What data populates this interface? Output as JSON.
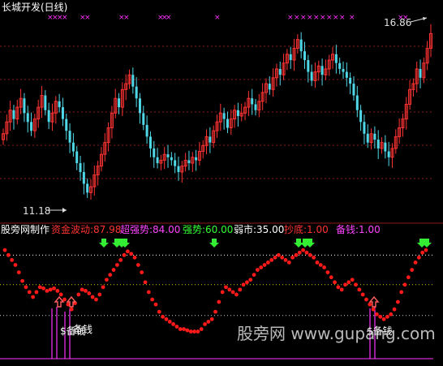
{
  "title": "长城开发(日线)",
  "price_labels": {
    "high": "16.86",
    "low": "11.18"
  },
  "indicator": {
    "name": "股旁网制作",
    "params": [
      {
        "label": "资金波动:87.98",
        "color": "#ff3333"
      },
      {
        "label": "超强势:84.00",
        "color": "#ff44ff"
      },
      {
        "label": "强势:60.00",
        "color": "#33ff33"
      },
      {
        "label": "弱市:35.00",
        "color": "#ffffff"
      },
      {
        "label": "抄底:1.00",
        "color": "#ff3333"
      },
      {
        "label": "备钱:1.00",
        "color": "#ff44ff"
      }
    ],
    "signal_labels": [
      "$备钱",
      "备钱",
      "$备钱"
    ]
  },
  "watermark": "股旁网 www.gupang.com",
  "colors": {
    "up_candle": "#ff3333",
    "down_candle": "#4fd8e8",
    "marker": "#ff33ff",
    "dot": "#ff1a1a",
    "green_arrow": "#33ee33",
    "pink_arrow": "#ff6060",
    "grid": "#8b1a1a"
  },
  "chart_data": [
    {
      "type": "candlestick",
      "title": "长城开发(日线)",
      "ylim": [
        10.5,
        17.5
      ],
      "annotations": [
        "16.86",
        "11.18"
      ],
      "close": [
        13.4,
        13.8,
        14.2,
        13.9,
        14.3,
        14.6,
        14.1,
        13.8,
        13.5,
        13.9,
        14.3,
        14.7,
        14.2,
        13.8,
        14.1,
        14.5,
        14.3,
        13.9,
        13.5,
        13.1,
        12.8,
        12.4,
        12.1,
        11.7,
        11.4,
        11.6,
        12.0,
        12.3,
        12.7,
        13.1,
        13.6,
        14.1,
        14.6,
        14.3,
        14.9,
        15.1,
        15.4,
        15.0,
        14.6,
        14.1,
        13.7,
        13.3,
        12.9,
        12.6,
        12.4,
        12.5,
        12.7,
        12.6,
        12.5,
        12.3,
        12.1,
        12.3,
        12.5,
        12.4,
        12.6,
        12.5,
        12.8,
        13.0,
        13.3,
        13.1,
        13.5,
        13.8,
        14.1,
        13.9,
        13.6,
        13.9,
        14.2,
        14.0,
        14.1,
        14.3,
        14.6,
        14.4,
        14.2,
        14.5,
        14.8,
        15.1,
        14.9,
        15.3,
        15.6,
        15.4,
        15.8,
        16.1,
        15.9,
        16.3,
        16.6,
        16.2,
        15.9,
        15.5,
        15.2,
        15.5,
        15.7,
        15.4,
        15.6,
        15.9,
        16.1,
        15.8,
        15.6,
        15.5,
        15.3,
        15.1,
        14.7,
        14.2,
        13.8,
        13.4,
        13.1,
        13.4,
        13.2,
        12.9,
        13.1,
        12.8,
        12.6,
        12.9,
        13.3,
        13.6,
        13.9,
        14.4,
        14.9,
        15.1,
        15.6,
        15.3,
        15.8,
        16.3,
        16.8
      ]
    },
    {
      "type": "scatter",
      "series_name": "资金波动",
      "ylim": [
        0,
        100
      ],
      "reference_lines": [
        84,
        60,
        35
      ],
      "values": [
        88,
        84,
        80,
        76,
        70,
        63,
        58,
        54,
        50,
        54,
        58,
        57,
        55,
        56,
        57,
        55,
        52,
        48,
        44,
        40,
        45,
        52,
        56,
        55,
        53,
        50,
        48,
        52,
        58,
        64,
        68,
        72,
        76,
        80,
        84,
        87,
        85,
        82,
        76,
        70,
        62,
        54,
        48,
        44,
        38,
        34,
        32,
        30,
        28,
        26,
        24,
        24,
        23,
        22,
        22,
        22,
        24,
        28,
        30,
        32,
        38,
        46,
        54,
        58,
        56,
        54,
        52,
        56,
        60,
        62,
        64,
        68,
        72,
        74,
        76,
        78,
        80,
        82,
        84,
        82,
        80,
        78,
        82,
        84,
        86,
        88,
        86,
        84,
        82,
        78,
        76,
        74,
        70,
        66,
        62,
        58,
        56,
        60,
        62,
        64,
        60,
        56,
        52,
        48,
        44,
        40,
        36,
        34,
        32,
        34,
        36,
        40,
        46,
        54,
        60,
        66,
        72,
        78,
        82,
        86,
        88
      ]
    }
  ]
}
